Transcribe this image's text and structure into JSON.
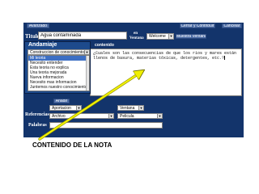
{
  "toolbar": {
    "back_label": "Avanzado",
    "save_label": "Cerrar y Contribuir",
    "cancel_label": "Cancelar"
  },
  "title_row": {
    "label": "Titulo",
    "value": "Agua contaminada",
    "window_label_line1": "en",
    "window_label_line2": "Ventana",
    "window_select": "Welcome",
    "show_window_button": "Muestra Ventana"
  },
  "scaffold": {
    "title": "Andamiaje",
    "header_tab": "contenido",
    "selected": "Construccion de conocimiento",
    "items": [
      "Mi teoria",
      "Necesito entender",
      "Esta teoria no explica",
      "Una teoria mejorada",
      "Nueva informacion",
      "Necesito mas informacion",
      "Juntemos nuestro conocimiento"
    ],
    "add_button": "Añadir"
  },
  "editor": {
    "text": "¿Cuales son las consecuencias de que los rios y mares están llenos de basura, materias tóxicas, detergentes, etc.?"
  },
  "bottom": {
    "contribution_select": "Aportacion",
    "window_select": "Ventana",
    "references_label": "Referencias",
    "references_select": "Archivo",
    "movie_select": "Pelicula",
    "keywords_label": "Palabras"
  },
  "annotation": {
    "caption": "CONTENIDO DE LA NOTA",
    "arrow_color": "#f0f000"
  },
  "colors": {
    "panel": "#13346b",
    "button": "#4d6da6",
    "selection": "#3d6fc4"
  }
}
